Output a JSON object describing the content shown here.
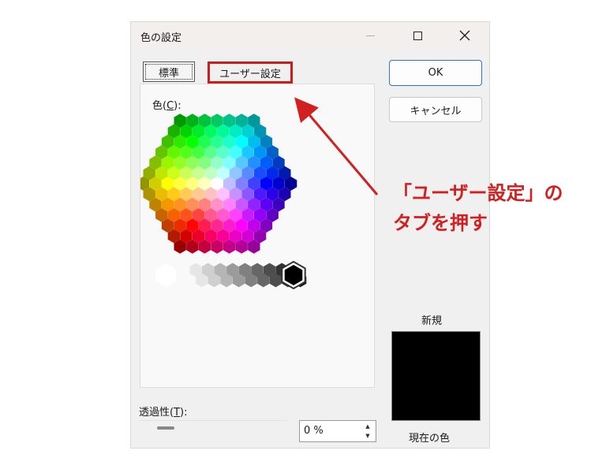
{
  "window": {
    "title": "色の設定"
  },
  "tabs": {
    "standard": "標準",
    "custom": "ユーザー設定"
  },
  "color_section": {
    "label_prefix": "色(",
    "label_key": "C",
    "label_suffix": "):"
  },
  "buttons": {
    "ok": "OK",
    "cancel": "キャンセル"
  },
  "preview": {
    "new_label": "新規",
    "current_label": "現在の色",
    "color": "#000000"
  },
  "transparency": {
    "label_prefix": "透過性(",
    "label_key": "T",
    "label_suffix": "):",
    "value": "0 %"
  },
  "annotation": {
    "line1": "「ユーザー設定」の",
    "line2": "タブを押す",
    "color": "#d21f1f"
  },
  "icons": {
    "minimize": "minimize-icon",
    "maximize": "maximize-icon",
    "close": "close-icon",
    "spin_up": "up-arrow-icon",
    "spin_down": "down-arrow-icon"
  }
}
